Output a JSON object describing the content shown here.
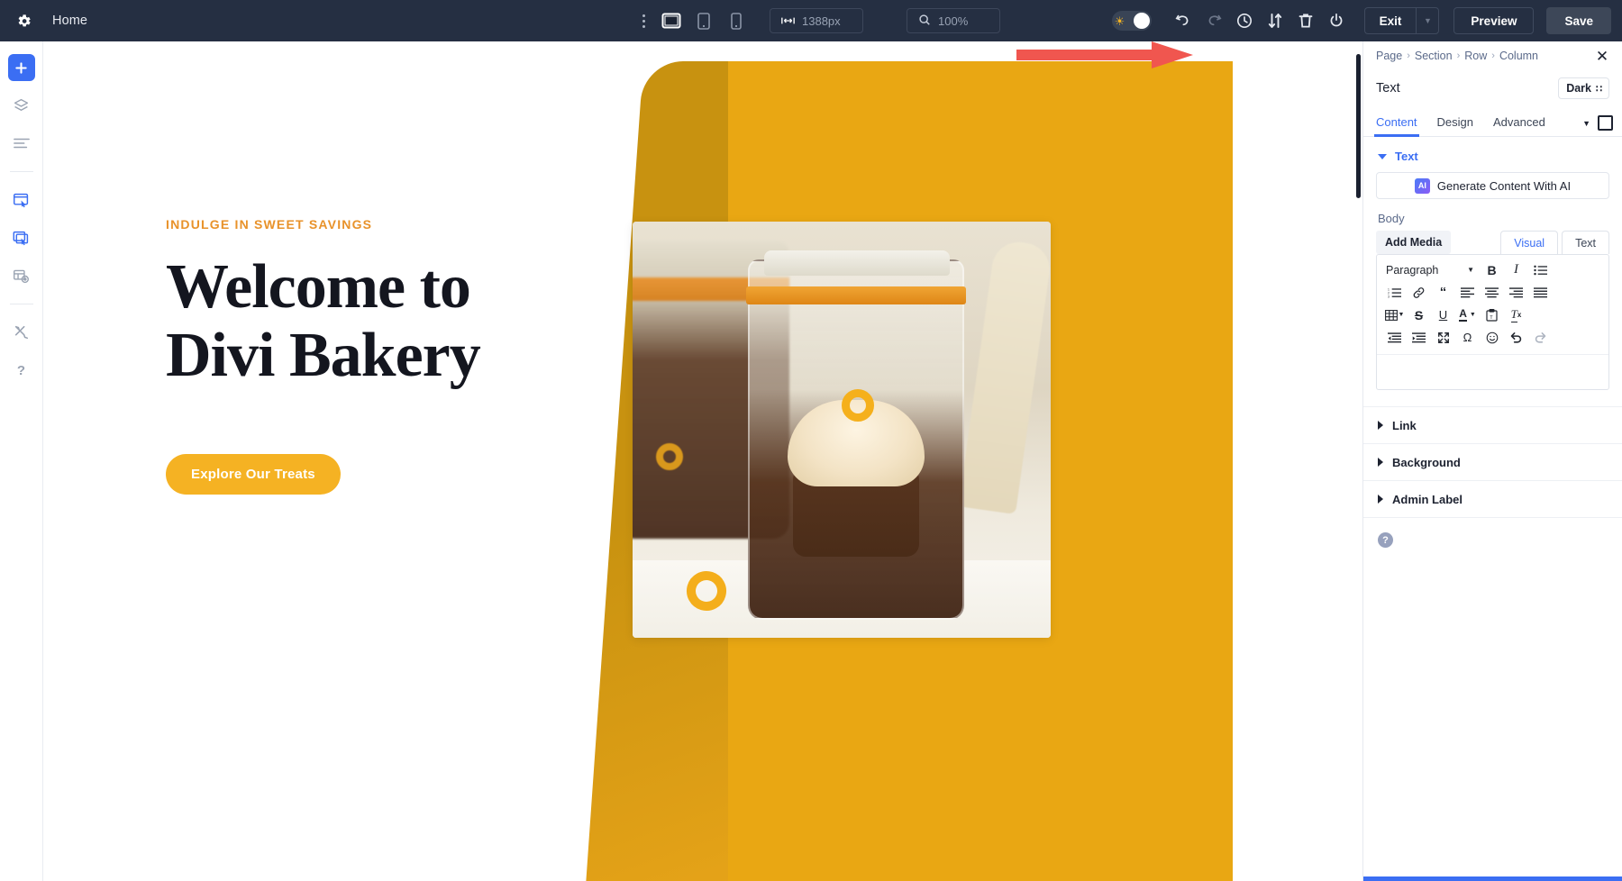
{
  "topbar": {
    "gear_icon": "gear-icon",
    "page_name": "Home",
    "kebab_icon": "more-vertical-icon",
    "devices": [
      {
        "name": "desktop",
        "label": "Desktop",
        "active": true
      },
      {
        "name": "tablet",
        "label": "Tablet",
        "active": false
      },
      {
        "name": "phone",
        "label": "Phone",
        "active": false
      }
    ],
    "width_value": "1388px",
    "width_icon": "width-arrows-icon",
    "zoom_value": "100%",
    "zoom_icon": "magnifier-icon",
    "theme_toggle": {
      "icon": "sun-icon",
      "state": "light"
    },
    "actions": [
      {
        "name": "undo-icon",
        "label": "Undo"
      },
      {
        "name": "redo-icon",
        "label": "Redo"
      },
      {
        "name": "history-clock-icon",
        "label": "History"
      },
      {
        "name": "portability-arrows-icon",
        "label": "Portability"
      },
      {
        "name": "trash-icon",
        "label": "Clear Layout"
      },
      {
        "name": "power-icon",
        "label": "Disable"
      }
    ],
    "exit_label": "Exit",
    "exit_caret_icon": "chevron-down-icon",
    "preview_label": "Preview",
    "save_label": "Save"
  },
  "rail": {
    "items": [
      {
        "name": "add-icon",
        "label": "Add",
        "style": "primary"
      },
      {
        "name": "layers-icon",
        "label": "Layers",
        "style": "grey"
      },
      {
        "name": "list-icon",
        "label": "Wireframe",
        "style": "grey"
      },
      {
        "name": "responsive-edit-icon",
        "label": "Edit Content",
        "style": "blue"
      },
      {
        "name": "duplicate-edit-icon",
        "label": "Clone",
        "style": "blue"
      },
      {
        "name": "preview-module-icon",
        "label": "Preview Module",
        "style": "grey"
      },
      {
        "name": "tools-icon",
        "label": "Tools",
        "style": "grey"
      },
      {
        "name": "help-question-icon",
        "label": "Help",
        "style": "grey"
      }
    ]
  },
  "canvas": {
    "eyebrow": "INDULGE IN SWEET SAVINGS",
    "title_line1": "Welcome to",
    "title_line2": "Divi Bakery",
    "cta_label": "Explore Our Treats",
    "photo_alt": "Chocolate cupcake dessert in a glass jar",
    "accent_yellow": "#E9A713",
    "accent_orange": "#E8922A",
    "cta_color": "#F5B223",
    "heading_color": "#14161F"
  },
  "annotation": {
    "arrow_color": "#F0564F",
    "arrow_name": "red-pointer-arrow"
  },
  "panel": {
    "breadcrumb": [
      "Page",
      "Section",
      "Row",
      "Column"
    ],
    "breadcrumb_sep": "›",
    "close_icon": "close-icon",
    "module_title": "Text",
    "mode_label": "Dark",
    "mode_icon": "color-swatch-icon",
    "tabs": [
      {
        "label": "Content",
        "active": true
      },
      {
        "label": "Design",
        "active": false
      },
      {
        "label": "Advanced",
        "active": false
      }
    ],
    "tabs_right": [
      {
        "name": "chevron-down-icon"
      },
      {
        "name": "expand-square-icon"
      }
    ],
    "section_text_label": "Text",
    "ai_button_label": "Generate Content With AI",
    "ai_badge_text": "AI",
    "body_label": "Body",
    "add_media_label": "Add Media",
    "editor_tabs": [
      {
        "label": "Visual",
        "active": true
      },
      {
        "label": "Text",
        "active": false
      }
    ],
    "editor_format_label": "Paragraph",
    "editor_toolbar_rows": [
      [
        {
          "name": "format-select",
          "glyph": "Paragraph"
        },
        {
          "name": "bold-icon",
          "glyph": "B"
        },
        {
          "name": "italic-icon",
          "glyph": "I"
        },
        {
          "name": "bullet-list-icon",
          "glyph": "≡"
        }
      ],
      [
        {
          "name": "numbered-list-icon",
          "glyph": "1≡"
        },
        {
          "name": "link-icon",
          "glyph": "🔗"
        },
        {
          "name": "blockquote-icon",
          "glyph": "“"
        },
        {
          "name": "align-left-icon",
          "glyph": "≡"
        },
        {
          "name": "align-center-icon",
          "glyph": "≡"
        },
        {
          "name": "align-right-icon",
          "glyph": "≡"
        },
        {
          "name": "align-justify-icon",
          "glyph": "≡"
        }
      ],
      [
        {
          "name": "table-icon",
          "glyph": "▦"
        },
        {
          "name": "strikethrough-icon",
          "glyph": "S"
        },
        {
          "name": "underline-icon",
          "glyph": "U"
        },
        {
          "name": "text-color-icon",
          "glyph": "A"
        },
        {
          "name": "paste-as-text-icon",
          "glyph": "📋"
        },
        {
          "name": "clear-formatting-icon",
          "glyph": "Tx"
        }
      ],
      [
        {
          "name": "outdent-icon",
          "glyph": "≡"
        },
        {
          "name": "indent-icon",
          "glyph": "≡"
        },
        {
          "name": "fullscreen-icon",
          "glyph": "⛶"
        },
        {
          "name": "special-character-icon",
          "glyph": "Ω"
        },
        {
          "name": "emoji-icon",
          "glyph": "☺"
        },
        {
          "name": "undo-icon",
          "glyph": "↶"
        },
        {
          "name": "redo-icon",
          "glyph": "↷"
        }
      ]
    ],
    "editor_content": "",
    "accordions": [
      {
        "label": "Link",
        "expanded": false
      },
      {
        "label": "Background",
        "expanded": false
      },
      {
        "label": "Admin Label",
        "expanded": false
      }
    ],
    "help_icon": "help-question-icon",
    "accent_blue": "#3B6EF3"
  }
}
